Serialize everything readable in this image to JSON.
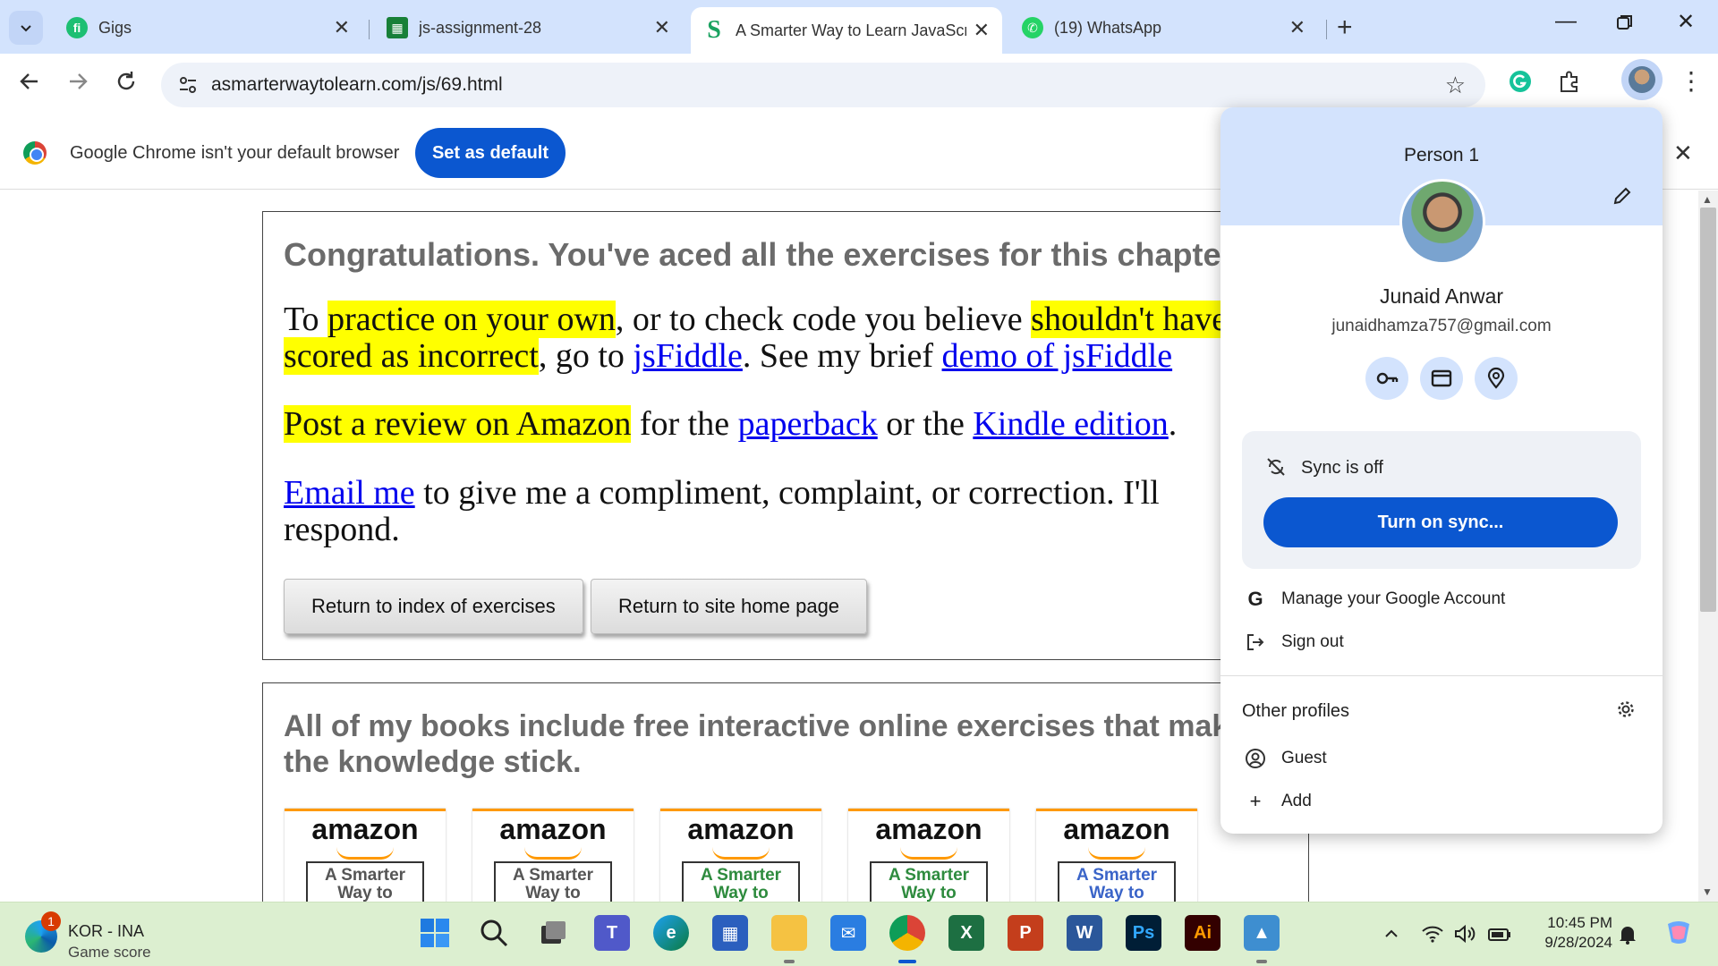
{
  "tabs": [
    {
      "title": "Gigs",
      "favicon": "fiverr-icon",
      "color": "#1dbf73"
    },
    {
      "title": "js-assignment-28",
      "favicon": "sheets-icon",
      "color": "#188038"
    },
    {
      "title": "A Smarter Way to Learn JavaScr",
      "favicon": "smarter-way-icon",
      "color": "#1aa260",
      "active": true
    },
    {
      "title": "(19) WhatsApp",
      "favicon": "whatsapp-icon",
      "color": "#25d366"
    }
  ],
  "address_bar": {
    "url": "asmarterwaytolearn.com/js/69.html"
  },
  "infobar": {
    "message": "Google Chrome isn't your default browser",
    "button": "Set as default"
  },
  "page": {
    "congrats": "Congratulations. You've aced all the exercises for this chapter.",
    "p1": {
      "hl1": "practice on your own",
      "t2": ", or to check code you believe ",
      "hl2": "shouldn't have been scored as incorrect",
      "t3": ", go to ",
      "link1": "jsFiddle",
      "t4": ". See my brief ",
      "link2": "demo of jsFiddle",
      "lead": "To "
    },
    "p2": {
      "hl": "Post a review on Amazon",
      "t1": " for the ",
      "link1": "paperback",
      "t2": " or the ",
      "link2": "Kindle edition",
      "t3": "."
    },
    "p3": {
      "link": "Email me",
      "text": " to give me a compliment, complaint, or correction. I'll respond."
    },
    "buttons": {
      "return_index": "Return to index of exercises",
      "return_home": "Return to site home page"
    },
    "books_heading": "All of my books include free interactive online exercises that make the knowledge stick.",
    "books": [
      {
        "brand": "amazon",
        "cover": "A Smarter Way to",
        "color": "#555"
      },
      {
        "brand": "amazon",
        "cover": "A Smarter Way to",
        "color": "#555"
      },
      {
        "brand": "amazon",
        "cover": "A Smarter Way to",
        "color": "#2e8b3e"
      },
      {
        "brand": "amazon",
        "cover": "A Smarter Way to",
        "color": "#2e8b3e"
      },
      {
        "brand": "amazon",
        "cover": "A Smarter Way to",
        "color": "#3a64c8"
      }
    ]
  },
  "profile": {
    "header": "Person 1",
    "name": "Junaid Anwar",
    "email": "junaidhamza757@gmail.com",
    "sync_status": "Sync is off",
    "sync_button": "Turn on sync...",
    "manage": "Manage your Google Account",
    "signout": "Sign out",
    "other_profiles": "Other profiles",
    "guest": "Guest",
    "add": "Add"
  },
  "taskbar": {
    "weather_title": "KOR - INA",
    "weather_sub": "Game score",
    "badge": "1",
    "time": "10:45 PM",
    "date": "9/28/2024"
  },
  "colors": {
    "accent": "#0b57d0",
    "tabstrip": "#d3e3fd",
    "taskbar": "#dcefd0",
    "highlight": "#ffff00",
    "link": "#0000ee"
  }
}
